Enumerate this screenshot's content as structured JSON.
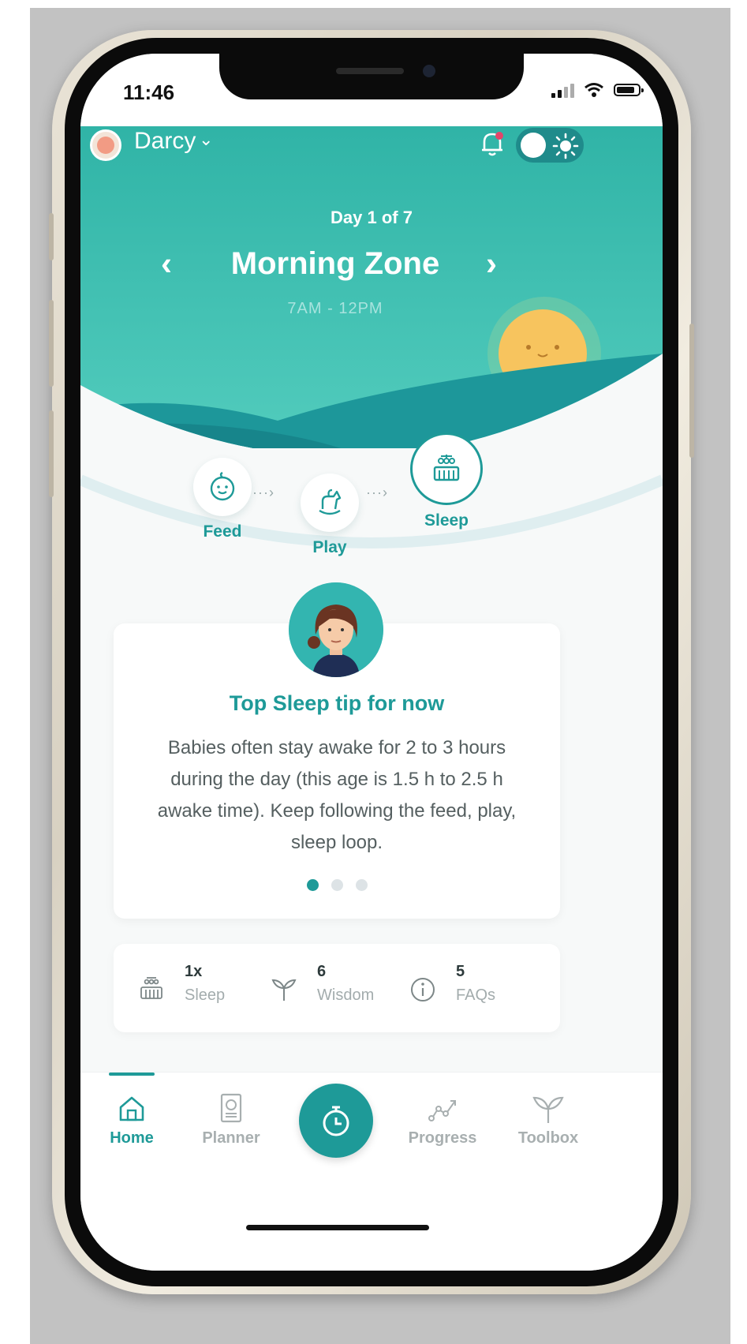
{
  "status_bar": {
    "time": "11:46"
  },
  "header": {
    "user_name": "Darcy",
    "user_chevron": "⌄"
  },
  "zone": {
    "day_label": "Day 1 of 7",
    "title": "Morning Zone",
    "time_range": "7AM - 12PM",
    "prev_glyph": "‹",
    "next_glyph": "›"
  },
  "steps": [
    {
      "label": "Feed",
      "icon": "baby-face-icon",
      "active": false
    },
    {
      "label": "Play",
      "icon": "rocking-horse-icon",
      "active": false
    },
    {
      "label": "Sleep",
      "icon": "crib-icon",
      "active": true
    }
  ],
  "tip_card": {
    "title": "Top Sleep tip for now",
    "body": "Babies often stay awake for 2 to 3 hours during the day (this age is 1.5 h to 2.5 h awake time). Keep following the feed, play, sleep loop.",
    "page_count": 3,
    "current_page": 1
  },
  "stats": [
    {
      "count": "1x",
      "label": "Sleep",
      "icon": "crib-icon"
    },
    {
      "count": "6",
      "label": "Wisdom",
      "icon": "sprout-icon"
    },
    {
      "count": "5",
      "label": "FAQs",
      "icon": "info-icon"
    }
  ],
  "tabs": [
    {
      "label": "Home",
      "icon": "home-icon",
      "active": true
    },
    {
      "label": "Planner",
      "icon": "planner-icon",
      "active": false
    },
    {
      "label": "",
      "icon": "stopwatch-icon",
      "active": false
    },
    {
      "label": "Progress",
      "icon": "progress-chart-icon",
      "active": false
    },
    {
      "label": "Toolbox",
      "icon": "sprout-icon",
      "active": false
    }
  ],
  "colors": {
    "brand_teal": "#1e9a98",
    "header_teal": "#3cc3b6",
    "hill_dark": "#1a8b8f",
    "sun": "#f7c45e",
    "background": "#f7f9f9"
  }
}
